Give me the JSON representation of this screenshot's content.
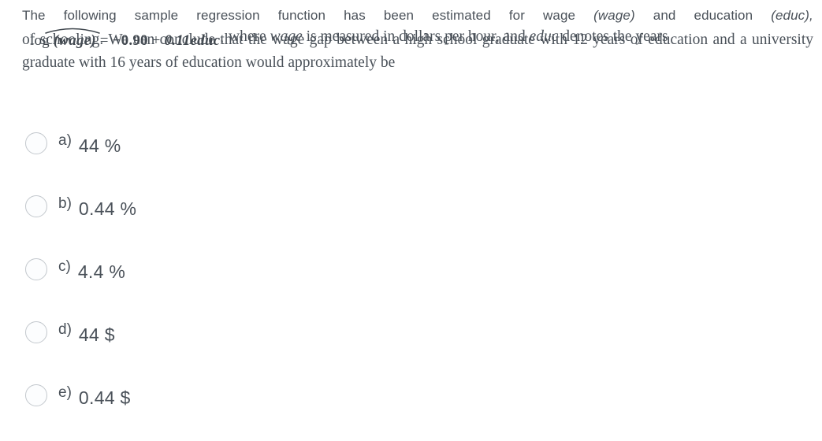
{
  "question": {
    "line1_words": [
      "The",
      "following",
      "sample",
      "regression",
      "function",
      "has",
      "been",
      "estimated",
      "for",
      "wage",
      "(wage)",
      "and",
      "education",
      "(educ),"
    ],
    "equation": {
      "log_fn": "log",
      "hat_arg": "(wage)",
      "equals": "=",
      "intercept": "−0.90",
      "plus": "+",
      "slope_term": "0.11educ",
      "trailing_punctuation": ","
    },
    "after_equation": "where wage is measured in dollars per hour, and educ denotes the years",
    "after_equation_italic_1": "wage",
    "after_equation_italic_2": "educ",
    "tail": "of schooling. We can conclude that the wage gap between a high school graduate with 12 years of education and a university graduate with 16 years of education would approximately be"
  },
  "options": [
    {
      "letter": "a)",
      "text": "44 %"
    },
    {
      "letter": "b)",
      "text": "0.44 %"
    },
    {
      "letter": "c)",
      "text": "4.4 %"
    },
    {
      "letter": "d)",
      "text": "44 $"
    },
    {
      "letter": "e)",
      "text": "0.44 $"
    }
  ],
  "colors": {
    "text": "#4a5159",
    "radio_border": "#c3c8cd",
    "background": "#ffffff"
  }
}
